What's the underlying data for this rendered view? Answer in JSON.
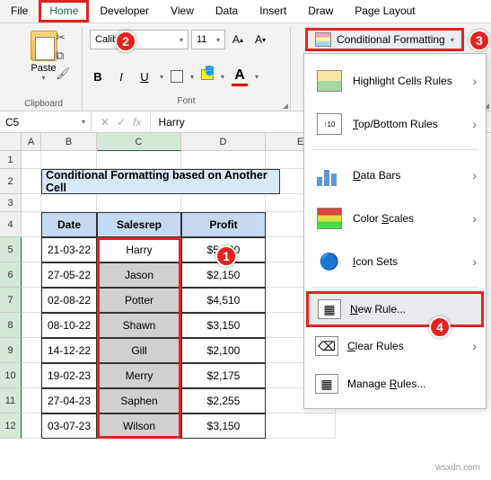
{
  "menu": {
    "file": "File",
    "home": "Home",
    "developer": "Developer",
    "view": "View",
    "data": "Data",
    "insert": "Insert",
    "draw": "Draw",
    "page_layout": "Page Layout"
  },
  "ribbon": {
    "paste": "Paste",
    "clipboard": "Clipboard",
    "font_name": "Calibri",
    "font_size": "11",
    "font": "Font",
    "bold": "B",
    "italic": "I",
    "underline": "U",
    "cf_label": "Conditional Formatting"
  },
  "cf_menu": {
    "highlight": "Highlight Cells Rules",
    "topbottom": "Top/Bottom Rules",
    "databars": "Data Bars",
    "colorscales": "Color Scales",
    "iconsets": "Icon Sets",
    "newrule": "New Rule...",
    "clear": "Clear Rules",
    "manage": "Manage Rules..."
  },
  "formula": {
    "name": "C5",
    "value": "Harry",
    "fx": "fx"
  },
  "cols": {
    "A": "A",
    "B": "B",
    "C": "C",
    "D": "D",
    "E": "E"
  },
  "rows": [
    "1",
    "2",
    "3",
    "4",
    "5",
    "6",
    "7",
    "8",
    "9",
    "10",
    "11",
    "12"
  ],
  "title": "Conditional Formatting based on Another Cell",
  "headers": {
    "date": "Date",
    "salesrep": "Salesrep",
    "profit": "Profit"
  },
  "data": [
    {
      "date": "21-03-22",
      "rep": "Harry",
      "profit": "$5,000"
    },
    {
      "date": "27-05-22",
      "rep": "Jason",
      "profit": "$2,150"
    },
    {
      "date": "02-08-22",
      "rep": "Potter",
      "profit": "$4,510"
    },
    {
      "date": "08-10-22",
      "rep": "Shawn",
      "profit": "$3,150"
    },
    {
      "date": "14-12-22",
      "rep": "Gill",
      "profit": "$2,100"
    },
    {
      "date": "19-02-23",
      "rep": "Merry",
      "profit": "$2,175"
    },
    {
      "date": "27-04-23",
      "rep": "Saphen",
      "profit": "$2,255"
    },
    {
      "date": "03-07-23",
      "rep": "Wilson",
      "profit": "$3,150"
    }
  ],
  "callouts": {
    "c1": "1",
    "c2": "2",
    "c3": "3",
    "c4": "4"
  },
  "watermark": "wsxdn.com"
}
